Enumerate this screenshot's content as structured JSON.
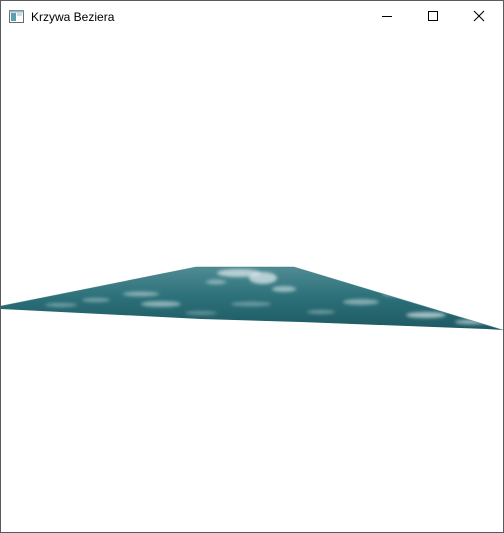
{
  "window": {
    "title": "Krzywa Beziera",
    "icon": "app-window-icon",
    "controls": {
      "minimize_icon": "minimize-icon",
      "maximize_icon": "maximize-icon",
      "close_icon": "close-icon"
    }
  },
  "scene": {
    "surface_texture": "water",
    "colors": {
      "deep": "#1e5962",
      "mid": "#2b6f78",
      "light": "#4f8b93",
      "foam": "#d9e7ea"
    }
  }
}
